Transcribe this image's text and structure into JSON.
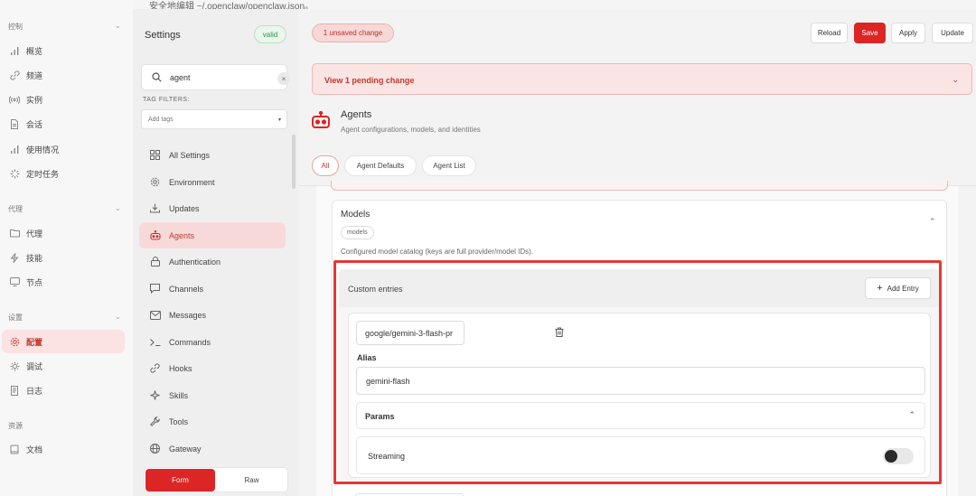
{
  "top_hint": "安全地编辑 ~/.openclaw/openclaw.json。",
  "nav": {
    "groups": [
      {
        "title": "控制",
        "items": [
          {
            "label": "概览",
            "icon": "bar-chart-icon"
          },
          {
            "label": "频道",
            "icon": "link-icon"
          },
          {
            "label": "实例",
            "icon": "broadcast-icon"
          },
          {
            "label": "会话",
            "icon": "document-icon"
          },
          {
            "label": "使用情况",
            "icon": "bar-chart-icon"
          },
          {
            "label": "定时任务",
            "icon": "loader-icon"
          }
        ]
      },
      {
        "title": "代理",
        "items": [
          {
            "label": "代理",
            "icon": "folder-icon"
          },
          {
            "label": "技能",
            "icon": "zap-icon"
          },
          {
            "label": "节点",
            "icon": "monitor-icon"
          }
        ]
      },
      {
        "title": "设置",
        "items": [
          {
            "label": "配置",
            "icon": "gear-icon",
            "active": true
          },
          {
            "label": "调试",
            "icon": "bug-icon"
          },
          {
            "label": "日志",
            "icon": "scroll-icon"
          }
        ]
      },
      {
        "title": "资源",
        "items": [
          {
            "label": "文档",
            "icon": "book-icon"
          }
        ]
      }
    ]
  },
  "settings": {
    "title": "Settings",
    "valid_badge": "valid",
    "search_value": "agent",
    "clear_symbol": "×",
    "tag_filters_label": "TAG FILTERS:",
    "tag_placeholder": "Add tags",
    "items": [
      {
        "label": "All Settings",
        "icon": "grid-icon"
      },
      {
        "label": "Environment",
        "icon": "gear-icon"
      },
      {
        "label": "Updates",
        "icon": "download-icon"
      },
      {
        "label": "Agents",
        "icon": "robot-icon",
        "active": true
      },
      {
        "label": "Authentication",
        "icon": "lock-icon"
      },
      {
        "label": "Channels",
        "icon": "chat-icon"
      },
      {
        "label": "Messages",
        "icon": "mail-icon"
      },
      {
        "label": "Commands",
        "icon": "terminal-icon"
      },
      {
        "label": "Hooks",
        "icon": "link-icon"
      },
      {
        "label": "Skills",
        "icon": "sparkle-icon"
      },
      {
        "label": "Tools",
        "icon": "wrench-icon"
      },
      {
        "label": "Gateway",
        "icon": "globe-icon"
      }
    ],
    "mode_form": "Form",
    "mode_raw": "Raw"
  },
  "main": {
    "unsaved": "1 unsaved change",
    "buttons": {
      "reload": "Reload",
      "save": "Save",
      "apply": "Apply",
      "update": "Update"
    },
    "pending": "View 1 pending change",
    "section_title": "Agents",
    "section_subtitle": "Agent configurations, models, and identities",
    "tabs": [
      "All",
      "Agent Defaults",
      "Agent List"
    ],
    "models": {
      "title": "Models",
      "chip": "models",
      "description": "Configured model catalog (keys are full provider/model IDs).",
      "custom_entries_title": "Custom entries",
      "add_entry": "Add Entry",
      "entry": {
        "model_id": "google/gemini-3-flash-pr",
        "alias_label": "Alias",
        "alias_value": "gemini-flash",
        "params_title": "Params",
        "streaming_label": "Streaming",
        "streaming_on": false
      }
    }
  },
  "colors": {
    "accent": "#dc2626",
    "accent_soft": "#fbe4e4",
    "valid": "#2e9a4f"
  }
}
